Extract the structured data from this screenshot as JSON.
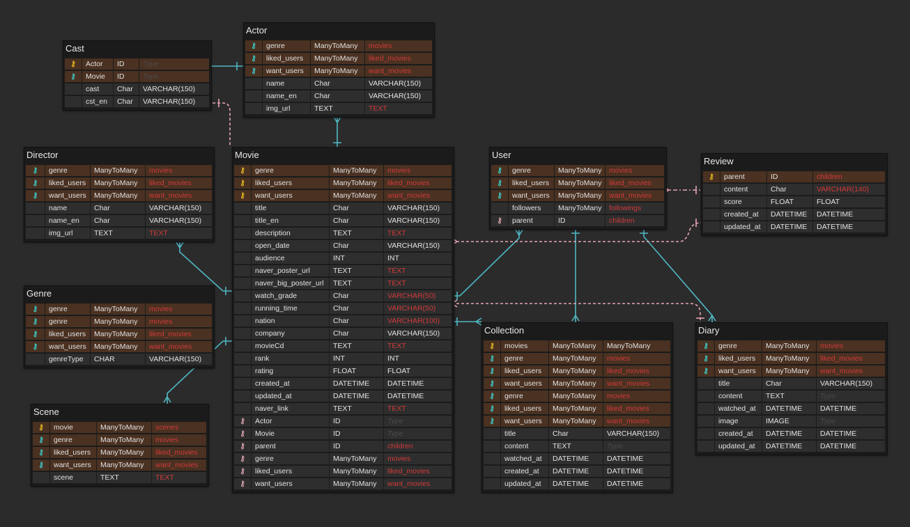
{
  "colors": {
    "background": "#2b2b2b",
    "primary_key": "#e3b81f",
    "foreign_key": "#3cc7c7",
    "relation_key": "#d9a2ab",
    "highlight_row": "#4a3121",
    "red_type": "#d23a3a",
    "teal_link": "#4fb8c4",
    "pink_link": "#e8a6b3"
  },
  "key_icon": "key-icon",
  "tables": [
    {
      "name": "Cast",
      "rows": [
        {
          "key": "pk",
          "field": "Actor",
          "type": "ID",
          "db": "Type",
          "style": "ph"
        },
        {
          "key": "fk",
          "field": "Movie",
          "type": "ID",
          "db": "Type",
          "style": "ph"
        },
        {
          "key": "",
          "field": "cast",
          "type": "Char",
          "db": "VARCHAR(150)",
          "style": ""
        },
        {
          "key": "",
          "field": "cst_en",
          "type": "Char",
          "db": "VARCHAR(150)",
          "style": ""
        }
      ]
    },
    {
      "name": "Actor",
      "rows": [
        {
          "key": "fk",
          "field": "genre",
          "type": "ManyToMany",
          "db": "movies",
          "style": "red"
        },
        {
          "key": "fk",
          "field": "liked_users",
          "type": "ManyToMany",
          "db": "liked_movies",
          "style": "red"
        },
        {
          "key": "fk",
          "field": "want_users",
          "type": "ManyToMany",
          "db": "want_movies",
          "style": "red"
        },
        {
          "key": "",
          "field": "name",
          "type": "Char",
          "db": "VARCHAR(150)",
          "style": ""
        },
        {
          "key": "",
          "field": "name_en",
          "type": "Char",
          "db": "VARCHAR(150)",
          "style": ""
        },
        {
          "key": "",
          "field": "img_url",
          "type": "TEXT",
          "db": "TEXT",
          "style": "red"
        }
      ]
    },
    {
      "name": "Director",
      "rows": [
        {
          "key": "fk",
          "field": "genre",
          "type": "ManyToMany",
          "db": "movies",
          "style": "red"
        },
        {
          "key": "fk",
          "field": "liked_users",
          "type": "ManyToMany",
          "db": "liked_movies",
          "style": "red"
        },
        {
          "key": "fk",
          "field": "want_users",
          "type": "ManyToMany",
          "db": "want_movies",
          "style": "red"
        },
        {
          "key": "",
          "field": "name",
          "type": "Char",
          "db": "VARCHAR(150)",
          "style": ""
        },
        {
          "key": "",
          "field": "name_en",
          "type": "Char",
          "db": "VARCHAR(150)",
          "style": ""
        },
        {
          "key": "",
          "field": "img_url",
          "type": "TEXT",
          "db": "TEXT",
          "style": "red"
        }
      ]
    },
    {
      "name": "Genre",
      "rows": [
        {
          "key": "fk",
          "field": "genre",
          "type": "ManyToMany",
          "db": "movies",
          "style": "red"
        },
        {
          "key": "fk",
          "field": "genre",
          "type": "ManyToMany",
          "db": "movies",
          "style": "red"
        },
        {
          "key": "fk",
          "field": "liked_users",
          "type": "ManyToMany",
          "db": "liked_movies",
          "style": "red"
        },
        {
          "key": "fk",
          "field": "want_users",
          "type": "ManyToMany",
          "db": "want_movies",
          "style": "red"
        },
        {
          "key": "",
          "field": "genreType",
          "type": "CHAR",
          "db": "VARCHAR(150)",
          "style": ""
        }
      ]
    },
    {
      "name": "Scene",
      "rows": [
        {
          "key": "pk",
          "field": "movie",
          "type": "ManyToMany",
          "db": "scenes",
          "style": "red"
        },
        {
          "key": "fk",
          "field": "genre",
          "type": "ManyToMany",
          "db": "movies",
          "style": "red"
        },
        {
          "key": "fk",
          "field": "liked_users",
          "type": "ManyToMany",
          "db": "liked_movies",
          "style": "red"
        },
        {
          "key": "fk",
          "field": "want_users",
          "type": "ManyToMany",
          "db": "want_movies",
          "style": "red"
        },
        {
          "key": "",
          "field": "scene",
          "type": "TEXT",
          "db": "TEXT",
          "style": "red"
        }
      ]
    },
    {
      "name": "Movie",
      "rows": [
        {
          "key": "pk",
          "field": "genre",
          "type": "ManyToMany",
          "db": "movies",
          "style": "red"
        },
        {
          "key": "pk",
          "field": "liked_users",
          "type": "ManyToMany",
          "db": "liked_movies",
          "style": "red"
        },
        {
          "key": "pk",
          "field": "want_users",
          "type": "ManyToMany",
          "db": "want_movies",
          "style": "red"
        },
        {
          "key": "",
          "field": "title",
          "type": "Char",
          "db": "VARCHAR(150)",
          "style": ""
        },
        {
          "key": "",
          "field": "title_en",
          "type": "Char",
          "db": "VARCHAR(150)",
          "style": ""
        },
        {
          "key": "",
          "field": "description",
          "type": "TEXT",
          "db": "TEXT",
          "style": "red"
        },
        {
          "key": "",
          "field": "open_date",
          "type": "Char",
          "db": "VARCHAR(150)",
          "style": ""
        },
        {
          "key": "",
          "field": "audience",
          "type": "INT",
          "db": "INT",
          "style": ""
        },
        {
          "key": "",
          "field": "naver_poster_url",
          "type": "TEXT",
          "db": "TEXT",
          "style": "red"
        },
        {
          "key": "",
          "field": "naver_big_poster_url",
          "type": "TEXT",
          "db": "TEXT",
          "style": "red"
        },
        {
          "key": "",
          "field": "watch_grade",
          "type": "Char",
          "db": "VARCHAR(50)",
          "style": "red"
        },
        {
          "key": "",
          "field": "running_time",
          "type": "Char",
          "db": "VARCHAR(50)",
          "style": "red"
        },
        {
          "key": "",
          "field": "nation",
          "type": "Char",
          "db": "VARCHAR(100)",
          "style": "red"
        },
        {
          "key": "",
          "field": "company",
          "type": "Char",
          "db": "VARCHAR(150)",
          "style": ""
        },
        {
          "key": "",
          "field": "movieCd",
          "type": "TEXT",
          "db": "TEXT",
          "style": "red"
        },
        {
          "key": "",
          "field": "rank",
          "type": "INT",
          "db": "INT",
          "style": ""
        },
        {
          "key": "",
          "field": "rating",
          "type": "FLOAT",
          "db": "FLOAT",
          "style": ""
        },
        {
          "key": "",
          "field": "created_at",
          "type": "DATETIME",
          "db": "DATETIME",
          "style": ""
        },
        {
          "key": "",
          "field": "updated_at",
          "type": "DATETIME",
          "db": "DATETIME",
          "style": ""
        },
        {
          "key": "",
          "field": "naver_link",
          "type": "TEXT",
          "db": "TEXT",
          "style": "red"
        },
        {
          "key": "rk",
          "field": "Actor",
          "type": "ID",
          "db": "Type",
          "style": "ph"
        },
        {
          "key": "rk",
          "field": "Movie",
          "type": "ID",
          "db": "Type",
          "style": "ph"
        },
        {
          "key": "rk",
          "field": "parent",
          "type": "ID",
          "db": "children",
          "style": "red"
        },
        {
          "key": "rk",
          "field": "genre",
          "type": "ManyToMany",
          "db": "movies",
          "style": "red"
        },
        {
          "key": "rk",
          "field": "liked_users",
          "type": "ManyToMany",
          "db": "liked_movies",
          "style": "red"
        },
        {
          "key": "rk",
          "field": "want_users",
          "type": "ManyToMany",
          "db": "want_movies",
          "style": "red"
        }
      ]
    },
    {
      "name": "User",
      "rows": [
        {
          "key": "fk",
          "field": "genre",
          "type": "ManyToMany",
          "db": "movies",
          "style": "red"
        },
        {
          "key": "fk",
          "field": "liked_users",
          "type": "ManyToMany",
          "db": "liked_movies",
          "style": "red"
        },
        {
          "key": "fk",
          "field": "want_users",
          "type": "ManyToMany",
          "db": "want_movies",
          "style": "red"
        },
        {
          "key": "",
          "field": "followers",
          "type": "ManyToMany",
          "db": "followings",
          "style": "red"
        },
        {
          "key": "rk",
          "field": "parent",
          "type": "ID",
          "db": "children",
          "style": "red"
        }
      ]
    },
    {
      "name": "Review",
      "rows": [
        {
          "key": "pk",
          "field": "parent",
          "type": "ID",
          "db": "children",
          "style": "red"
        },
        {
          "key": "",
          "field": "content",
          "type": "Char",
          "db": "VARCHAR(140)",
          "style": "red"
        },
        {
          "key": "",
          "field": "score",
          "type": "FLOAT",
          "db": "FLOAT",
          "style": ""
        },
        {
          "key": "",
          "field": "created_at",
          "type": "DATETIME",
          "db": "DATETIME",
          "style": ""
        },
        {
          "key": "",
          "field": "updated_at",
          "type": "DATETIME",
          "db": "DATETIME",
          "style": ""
        }
      ]
    },
    {
      "name": "Collection",
      "rows": [
        {
          "key": "pk",
          "field": "movies",
          "type": "ManyToMany",
          "db": "ManyToMany",
          "style": ""
        },
        {
          "key": "fk",
          "field": "genre",
          "type": "ManyToMany",
          "db": "movies",
          "style": "red"
        },
        {
          "key": "fk",
          "field": "liked_users",
          "type": "ManyToMany",
          "db": "liked_movies",
          "style": "red"
        },
        {
          "key": "fk",
          "field": "want_users",
          "type": "ManyToMany",
          "db": "want_movies",
          "style": "red"
        },
        {
          "key": "fk",
          "field": "genre",
          "type": "ManyToMany",
          "db": "movies",
          "style": "red"
        },
        {
          "key": "fk",
          "field": "liked_users",
          "type": "ManyToMany",
          "db": "liked_movies",
          "style": "red"
        },
        {
          "key": "fk",
          "field": "want_users",
          "type": "ManyToMany",
          "db": "want_movies",
          "style": "red"
        },
        {
          "key": "",
          "field": "title",
          "type": "Char",
          "db": "VARCHAR(150)",
          "style": ""
        },
        {
          "key": "",
          "field": "content",
          "type": "TEXT",
          "db": "Type",
          "style": "ph"
        },
        {
          "key": "",
          "field": "watched_at",
          "type": "DATETIME",
          "db": "DATETIME",
          "style": ""
        },
        {
          "key": "",
          "field": "created_at",
          "type": "DATETIME",
          "db": "DATETIME",
          "style": ""
        },
        {
          "key": "",
          "field": "updated_at",
          "type": "DATETIME",
          "db": "DATETIME",
          "style": ""
        }
      ]
    },
    {
      "name": "Diary",
      "rows": [
        {
          "key": "fk",
          "field": "genre",
          "type": "ManyToMany",
          "db": "movies",
          "style": "red"
        },
        {
          "key": "fk",
          "field": "liked_users",
          "type": "ManyToMany",
          "db": "liked_movies",
          "style": "red"
        },
        {
          "key": "fk",
          "field": "want_users",
          "type": "ManyToMany",
          "db": "want_movies",
          "style": "red"
        },
        {
          "key": "",
          "field": "title",
          "type": "Char",
          "db": "VARCHAR(150)",
          "style": ""
        },
        {
          "key": "",
          "field": "content",
          "type": "TEXT",
          "db": "Type",
          "style": "ph"
        },
        {
          "key": "",
          "field": "watched_at",
          "type": "DATETIME",
          "db": "DATETIME",
          "style": ""
        },
        {
          "key": "",
          "field": "image",
          "type": "IMAGE",
          "db": "Type",
          "style": "ph"
        },
        {
          "key": "",
          "field": "created_at",
          "type": "DATETIME",
          "db": "DATETIME",
          "style": ""
        },
        {
          "key": "",
          "field": "updated_at",
          "type": "DATETIME",
          "db": "DATETIME",
          "style": ""
        }
      ]
    }
  ]
}
